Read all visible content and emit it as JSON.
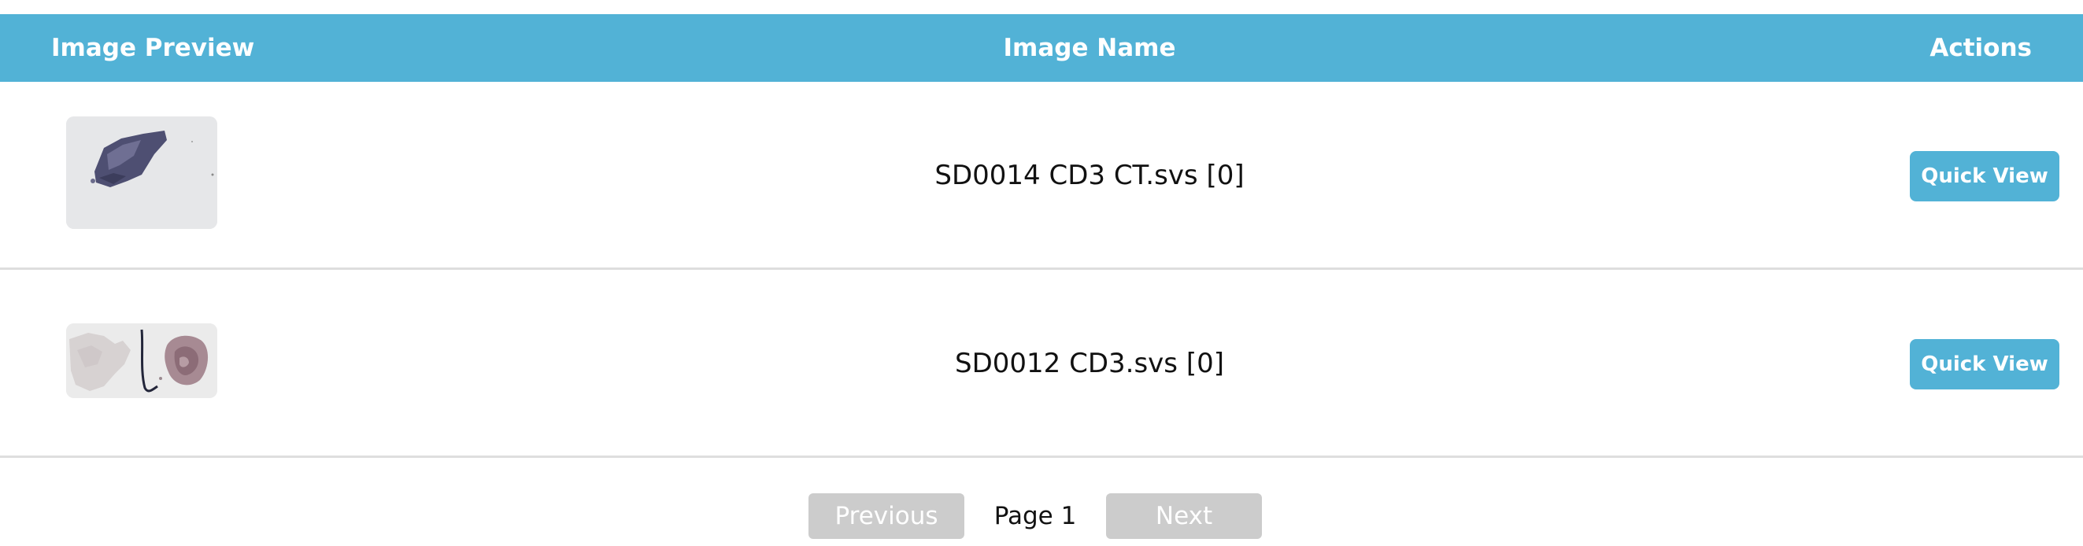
{
  "header": {
    "preview_label": "Image Preview",
    "name_label": "Image Name",
    "actions_label": "Actions"
  },
  "rows": [
    {
      "name": "SD0014 CD3 CT.svs [0]",
      "action_label": "Quick View",
      "thumbnail": "tissue-slide-thumbnail"
    },
    {
      "name": "SD0012 CD3.svs [0]",
      "action_label": "Quick View",
      "thumbnail": "tissue-slide-thumbnail"
    }
  ],
  "pagination": {
    "prev_label": "Previous",
    "page_label": "Page 1",
    "next_label": "Next"
  },
  "colors": {
    "accent": "#52b2d6",
    "disabled": "#cccccc",
    "divider": "#dedede"
  }
}
